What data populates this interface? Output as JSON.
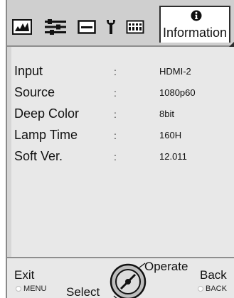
{
  "tabs": [
    {
      "name": "picture",
      "icon": "picture-icon"
    },
    {
      "name": "setting",
      "icon": "settings-sliders-icon"
    },
    {
      "name": "display",
      "icon": "screen-icon"
    },
    {
      "name": "tools",
      "icon": "tools-icon"
    },
    {
      "name": "system",
      "icon": "keyboard-icon"
    },
    {
      "name": "information",
      "icon": "info-icon",
      "label": "Information",
      "selected": true
    }
  ],
  "info_rows": [
    {
      "label": "Input",
      "sep": ":",
      "value": "HDMI-2"
    },
    {
      "label": "Source",
      "sep": ":",
      "value": "1080p60"
    },
    {
      "label": "Deep Color",
      "sep": ":",
      "value": "8bit"
    },
    {
      "label": "Lamp Time",
      "sep": ":",
      "value": "160H"
    },
    {
      "label": "Soft Ver.",
      "sep": ":",
      "value": "12.011"
    }
  ],
  "footer": {
    "exit_label": "Exit",
    "exit_key": "MENU",
    "select_label": "Select",
    "operate_label": "Operate",
    "back_label": "Back",
    "back_key": "BACK"
  },
  "colors": {
    "panel_bg": "#e8e8e8",
    "tabbar_bg": "#cfcfcf",
    "active_tab_bg": "#ffffff"
  }
}
